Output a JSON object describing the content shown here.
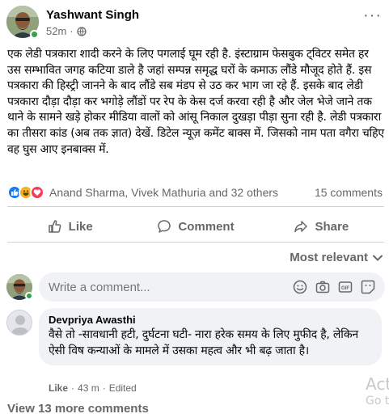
{
  "post": {
    "author": "Yashwant Singh",
    "time": "52m",
    "separator": "·",
    "body": "एक लेडी पत्रकारा शादी करने के लिए पगलाई घूम रही है. इंस्टाग्राम फेसबुक ट्विटर समेत हर उस सम्भावित जगह कटिया डाले है जहां सम्पन्न समृद्ध घरों के कमाऊ लौंडे मौजूद होते हैं. इस पत्रकारा की हिस्ट्री जानने के बाद लौंडे सब मंडप से उठ कर भाग जा रहे हैं. इसके बाद लेडी पत्रकारा दौड़ा दौड़ा कर भगोड़े लौंडों पर रेप के केस दर्ज करवा रही है और जेल भेजे जाने तक थाने के सामने खड़े होकर मीडिया वालों को आंसू निकाल दुखड़ा पीड़ा सुना रही है. लेडी पत्रकारा का तीसरा कांड (अब तक ज्ञात) देखें. डिटेल न्यूज़ कमेंट बाक्स में. जिसको नाम पता वगैरा चहिए वह घुस आए इनबाक्स में."
  },
  "reactions": {
    "icons": [
      "like-icon",
      "haha-icon",
      "love-icon"
    ],
    "names": "Anand Sharma, Vivek Mathuria and 32 others",
    "comments_count": "15 comments"
  },
  "actions": {
    "like": "Like",
    "comment": "Comment",
    "share": "Share"
  },
  "sort": {
    "label": "Most relevant"
  },
  "composer": {
    "placeholder": "Write a comment..."
  },
  "comment": {
    "name": "Devpriya Awasthi",
    "text": "वैसे तो -सावधानी हटी, दुर्घटना घटी- नारा हरेक समय के लिए मुफीद है, लेकिन ऐसी विष कन्याओं के मामले में उसका महत्व और भी बढ़ जाता है।",
    "like": "Like",
    "dot": "·",
    "time": "43 m",
    "edited": "Edited"
  },
  "view_more": "View 13 more comments",
  "watermark": {
    "line1": "Act",
    "line2": "Go t"
  },
  "colors": {
    "accent": "#1877f2",
    "online": "#31a24c",
    "muted": "#65676b",
    "bubble": "#f0f2f5"
  }
}
